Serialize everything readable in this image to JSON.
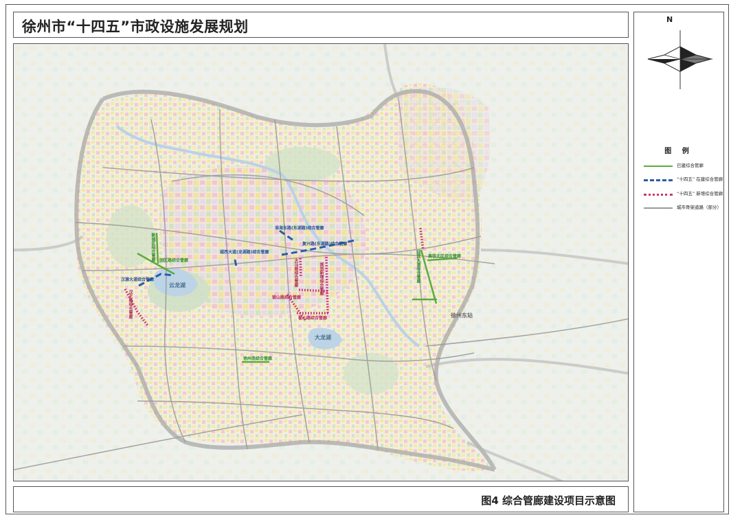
{
  "header": {
    "title": "徐州市“十四五”市政设施发展规划"
  },
  "footer": {
    "caption": "图4  综合管廊建设项目示意图"
  },
  "compass": {
    "north_label": "N"
  },
  "legend": {
    "title": "图 例",
    "items": [
      {
        "label": "已建综合管廊",
        "color": "#5aac3c",
        "style": "solid"
      },
      {
        "label": "“十四五” 在建综合管廊",
        "color": "#2a5ca8",
        "style": "dashed"
      },
      {
        "label": "“十四五” 新增综合管廊",
        "color": "#c8386e",
        "style": "dotted"
      },
      {
        "label": "城市骨架道路（部分）",
        "color": "#9a9a9a",
        "style": "solid"
      }
    ]
  },
  "map": {
    "place_labels": [
      {
        "text": "云龙湖"
      },
      {
        "text": "大龙湖"
      },
      {
        "text": "徐州东站"
      }
    ],
    "tunnel_labels": [
      {
        "text": "新城区综合管廊",
        "kind": "green"
      },
      {
        "text": "园区路综合管廊",
        "kind": "green"
      },
      {
        "text": "徐州南综合管廊",
        "kind": "green"
      },
      {
        "text": "迎宾大道综合管廊",
        "kind": "green"
      },
      {
        "text": "高铁北区综合管廊",
        "kind": "green"
      },
      {
        "text": "复兴路(东湖路)综合管廊",
        "kind": "blue"
      },
      {
        "text": "淮海东路(东湖路)综合管廊",
        "kind": "blue"
      },
      {
        "text": "城西大道(龙湖路)综合管廊",
        "kind": "blue"
      },
      {
        "text": "汉源大道综合管廊",
        "kind": "blue"
      },
      {
        "text": "大马路综合管廊",
        "kind": "red"
      },
      {
        "text": "银山路综合管廊",
        "kind": "red"
      },
      {
        "text": "翟山路综合管廊",
        "kind": "red"
      },
      {
        "text": "规划新增综合管廊",
        "kind": "red"
      },
      {
        "text": "汉王路综合管廊",
        "kind": "red"
      }
    ]
  }
}
